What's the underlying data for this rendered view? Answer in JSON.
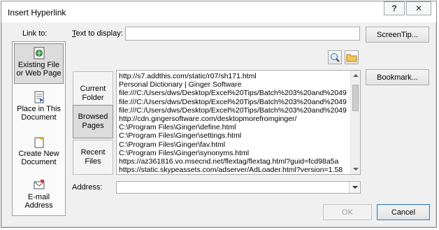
{
  "window": {
    "title": "Insert Hyperlink",
    "help_glyph": "?",
    "close_glyph": "✕"
  },
  "link_to": {
    "label": "Link to:",
    "items": [
      {
        "line1": "Existing File",
        "line2": "or Web Page",
        "icon": "web-page-icon"
      },
      {
        "line1": "Place in This",
        "line2": "Document",
        "icon": "document-place-icon"
      },
      {
        "line1": "Create New",
        "line2": "Document",
        "icon": "new-document-icon"
      },
      {
        "line1": "E-mail",
        "line2": "Address",
        "icon": "email-icon"
      }
    ]
  },
  "text_to_display": {
    "label": "Text to display:",
    "value": ""
  },
  "screentip_button": "ScreenTip...",
  "browse_icons": {
    "web": "browse-web-icon",
    "file": "browse-folder-icon"
  },
  "look_in": [
    {
      "line1": "Current",
      "line2": "Folder"
    },
    {
      "line1": "Browsed",
      "line2": "Pages"
    },
    {
      "line1": "Recent",
      "line2": "Files"
    }
  ],
  "file_list": [
    "http://s7.addthis.com/static/r07/sh171.html",
    "Personal Dictionary | Ginger Software",
    "file:///C:/Users/dws/Desktop/Excel%20Tips/Batch%203%20and%2049",
    "file:///C:/Users/dws/Desktop/Excel%20Tips/Batch%203%20and%2049",
    "file:///C:/Users/dws/Desktop/Excel%20Tips/Batch%203%20and%2049",
    "http://cdn.gingersoftware.com/desktopmorefromginger/",
    "C:\\Program Files\\Ginger\\define.html",
    "C:\\Program Files\\Ginger\\settings.html",
    "C:\\Program Files\\Ginger\\fav.html",
    "C:\\Program Files\\Ginger\\synonyms.html",
    "https://az361816.vo.msecnd.net/flextag/flextag.html?guid=fcd98a5a",
    "https://static.skypeassets.com/adserver/AdLoader.html?version=1.58"
  ],
  "bookmark_button": "Bookmark...",
  "address": {
    "label": "Address:",
    "value": ""
  },
  "ok_button": "OK",
  "cancel_button": "Cancel"
}
